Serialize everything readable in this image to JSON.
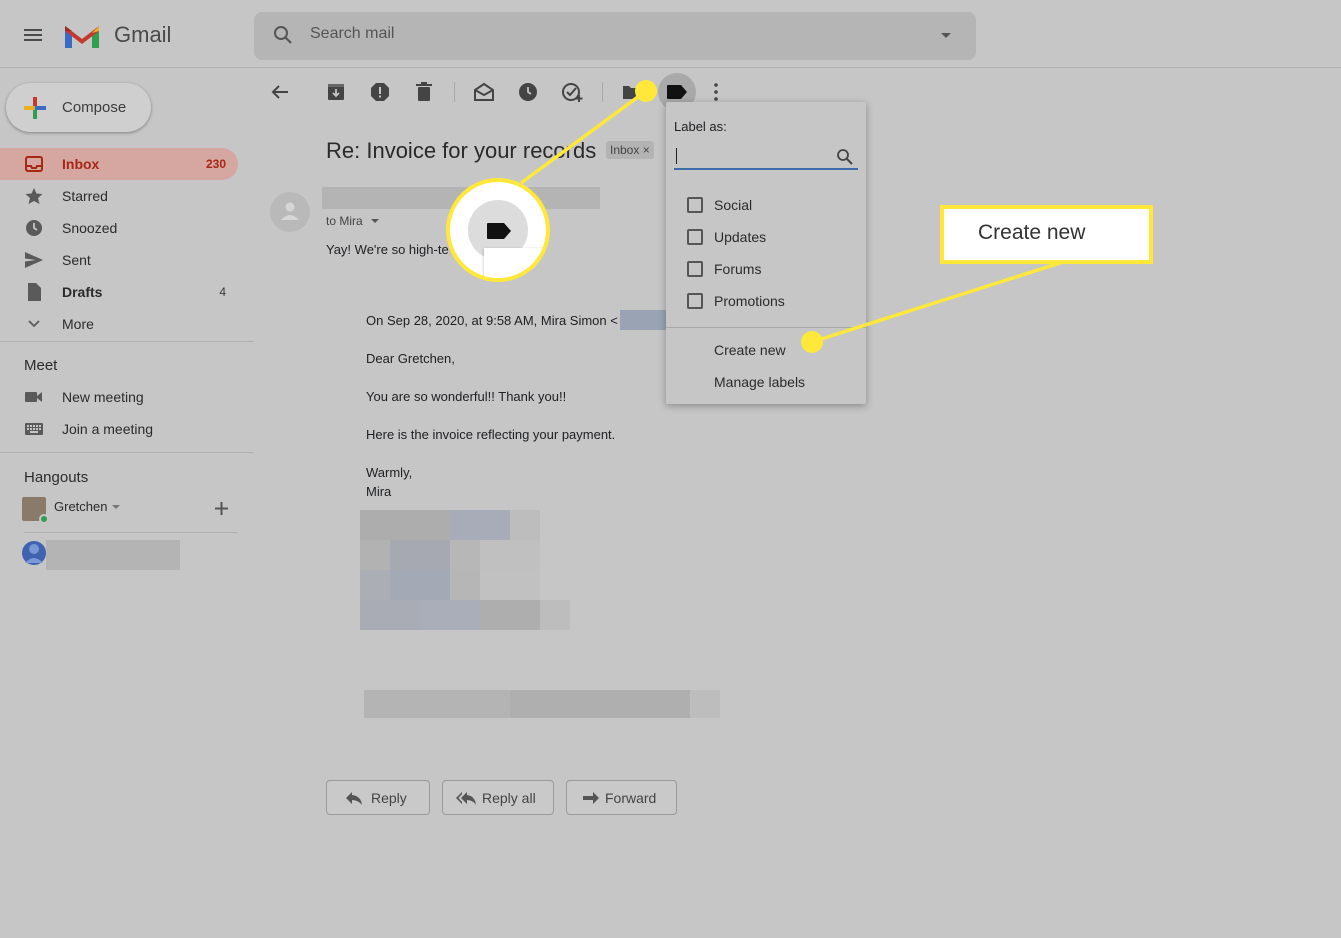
{
  "header": {
    "brand": "Gmail",
    "search_placeholder": "Search mail"
  },
  "sidebar": {
    "compose_label": "Compose",
    "items": [
      {
        "label": "Inbox",
        "count": "230",
        "icon": "inbox-icon"
      },
      {
        "label": "Starred",
        "count": "",
        "icon": "star-icon"
      },
      {
        "label": "Snoozed",
        "count": "",
        "icon": "clock-icon"
      },
      {
        "label": "Sent",
        "count": "",
        "icon": "send-icon"
      },
      {
        "label": "Drafts",
        "count": "4",
        "icon": "draft-icon"
      },
      {
        "label": "More",
        "count": "",
        "icon": "chevron-down-icon"
      }
    ],
    "meet": {
      "title": "Meet",
      "new_meeting": "New meeting",
      "join_meeting": "Join a meeting"
    },
    "hangouts": {
      "title": "Hangouts",
      "user": "Gretchen"
    }
  },
  "toolbar": {
    "icons": [
      "back-arrow-icon",
      "archive-icon",
      "report-spam-icon",
      "delete-icon",
      "mark-unread-icon",
      "snooze-icon",
      "add-task-icon",
      "move-to-icon",
      "label-icon",
      "more-icon"
    ]
  },
  "message": {
    "subject": "Re: Invoice for your records",
    "inbox_chip": "Inbox ×",
    "to": "to Mira",
    "preview": "Yay! We're so high-te",
    "quoted": {
      "header": "On Sep 28, 2020, at 9:58 AM, Mira Simon <",
      "greeting": "Dear Gretchen,",
      "line1": "You are so wonderful!! Thank you!!",
      "line2": "Here is the invoice reflecting your payment.",
      "closing": "Warmly,",
      "signature": "Mira"
    }
  },
  "actions": {
    "reply": "Reply",
    "reply_all": "Reply all",
    "forward": "Forward"
  },
  "label_menu": {
    "title": "Label as:",
    "input_value": "",
    "options": [
      "Social",
      "Updates",
      "Forums",
      "Promotions"
    ],
    "create_new": "Create new",
    "manage_labels": "Manage labels"
  },
  "callout": {
    "text": "Create new",
    "color": "#ffe83a"
  }
}
